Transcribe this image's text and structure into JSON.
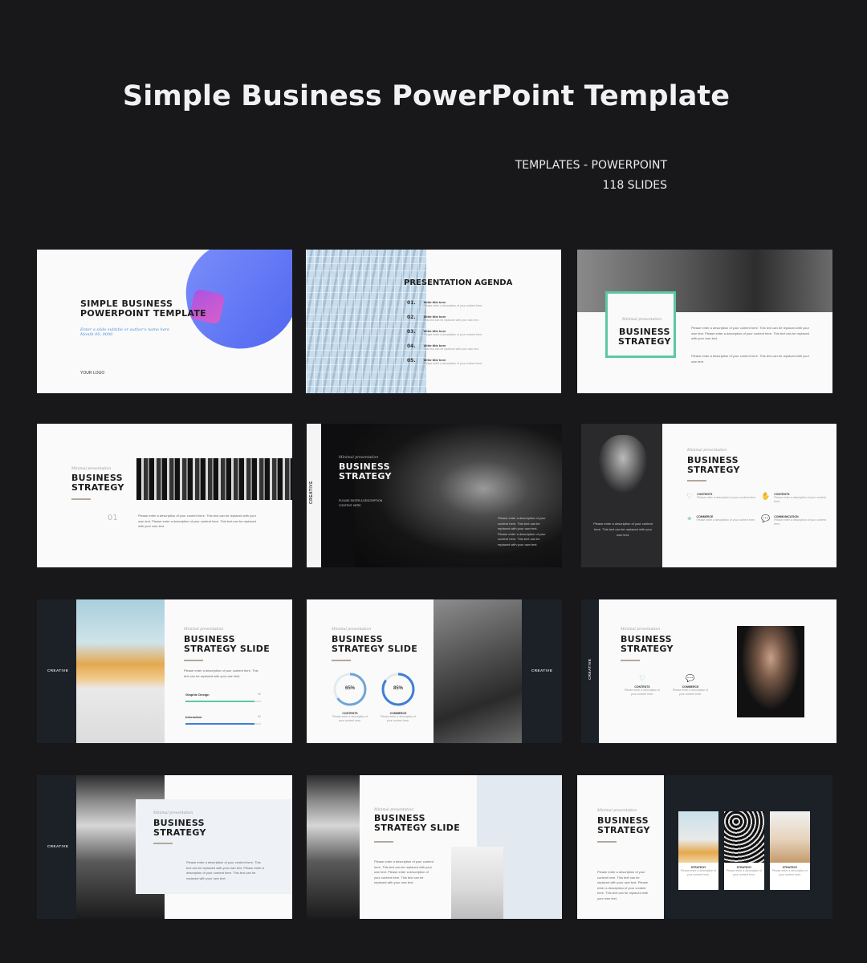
{
  "header": {
    "title": "Simple Business PowerPoint Template",
    "category": "TEMPLATES - POWERPOINT",
    "slides_count": "118 SLIDES"
  },
  "colors": {
    "background": "#18181b",
    "accent_green": "#5cc8a4",
    "accent_blue": "#4f65f0",
    "accent_pink": "#e35cc4"
  },
  "slide1": {
    "title_line1": "SIMPLE BUSINESS",
    "title_line2": "POWERPOINT TEMPLATE",
    "subtitle_line1": "Enter a slide subtitle or author's name here",
    "subtitle_line2": "Month 00, 0000",
    "logo": "YOUR LOGO"
  },
  "slide2": {
    "title": "PRESENTATION AGENDA",
    "items": [
      {
        "num": "01.",
        "title": "Write title here",
        "desc": "Please enter a description of your content here."
      },
      {
        "num": "02.",
        "title": "Write title here",
        "desc": "This text can be replaced with your own text."
      },
      {
        "num": "03.",
        "title": "Write title here",
        "desc": "Please enter a description of your content here."
      },
      {
        "num": "04.",
        "title": "Write title here",
        "desc": "This text can be replaced with your own text."
      },
      {
        "num": "05.",
        "title": "Write title here",
        "desc": "Please enter a description of your content here."
      }
    ]
  },
  "slide3": {
    "kicker": "Minimal presentation",
    "title_line1": "BUSINESS",
    "title_line2": "STRATEGY"
  },
  "slide4": {
    "kicker": "Minimal presentation",
    "title_line1": "BUSINESS",
    "title_line2": "STRATEGY",
    "number": "01"
  },
  "slide5": {
    "kicker": "Minimal presentation",
    "title_line1": "BUSINESS",
    "title_line2": "STRATEGY",
    "side_label": "CREATIVE",
    "cta": "PLEASE ENTER A DESCRIPTION CONTENT HERE."
  },
  "slide6": {
    "kicker": "Minimal presentation",
    "title_line1": "BUSINESS",
    "title_line2": "STRATEGY",
    "photo_caption": "Please enter a description of your content here. This text can be replaced with your own text.",
    "features": [
      {
        "icon": "heart-icon",
        "glyph": "♡",
        "label": "CONTENTS"
      },
      {
        "icon": "thumbs-up-icon",
        "glyph": "✋",
        "label": "CONTENTS"
      },
      {
        "icon": "link-icon",
        "glyph": "⚭",
        "label": "COMMERCE"
      },
      {
        "icon": "chat-icon",
        "glyph": "💬",
        "label": "COMMUNICATION"
      }
    ]
  },
  "slide7": {
    "kicker": "Minimal presentation",
    "title_line1": "BUSINESS",
    "title_line2": "STRATEGY SLIDE",
    "side_label": "CREATIVE",
    "bars": [
      {
        "label": "Graphic Design",
        "value": "92",
        "fill": 0.92
      },
      {
        "label": "Interaction",
        "value": "92",
        "fill": 0.92
      }
    ]
  },
  "slide8": {
    "kicker": "Minimal presentation",
    "title_line1": "BUSINESS",
    "title_line2": "STRATEGY SLIDE",
    "side_label": "CREATIVE",
    "rings": [
      {
        "value": "65%",
        "fill": 0.65,
        "label": "CONTENTS"
      },
      {
        "value": "85%",
        "fill": 0.85,
        "label": "COMMERCE"
      }
    ]
  },
  "slide9": {
    "kicker": "Minimal presentation",
    "title_line1": "BUSINESS",
    "title_line2": "STRATEGY",
    "side_label": "CREATIVE",
    "features": [
      {
        "icon": "heart-icon",
        "glyph": "♡",
        "label": "CONTENTS"
      },
      {
        "icon": "chat-icon",
        "glyph": "💬",
        "label": "COMMERCE"
      }
    ]
  },
  "slide10": {
    "kicker": "Minimal presentation",
    "title_line1": "BUSINESS",
    "title_line2": "STRATEGY",
    "side_label": "CREATIVE"
  },
  "slide11": {
    "kicker": "Minimal presentation",
    "title_line1": "BUSINESS",
    "title_line2": "STRATEGY SLIDE"
  },
  "slide12": {
    "kicker": "Minimal presentation",
    "title_line1": "BUSINESS",
    "title_line2": "STRATEGY",
    "cards": [
      {
        "label": "STRATEGY"
      },
      {
        "label": "STRATEGY"
      },
      {
        "label": "STRATEGY"
      }
    ]
  },
  "common": {
    "para_long": "Please enter a description of your content here. This text can be replaced with your own text. Please enter a description of your content here. This text can be replaced with your own text.",
    "para_short": "Please enter a description of your content here. This text can be replaced with your own text.",
    "para_card": "Please enter a description of your content here."
  }
}
